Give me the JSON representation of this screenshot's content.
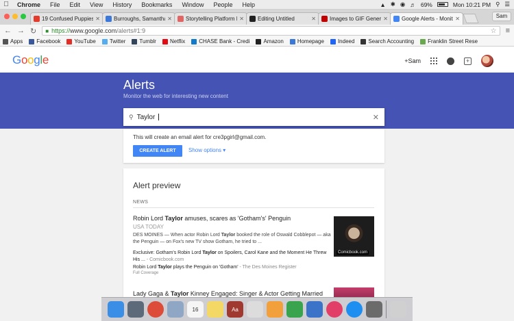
{
  "menubar": {
    "app": "Chrome",
    "items": [
      "File",
      "Edit",
      "View",
      "History",
      "Bookmarks",
      "Window",
      "People",
      "Help"
    ],
    "battery": "69%",
    "clock": "Mon 10:21 PM"
  },
  "tabs": [
    {
      "title": "19 Confused Puppies Lo",
      "color": "#e33b2e"
    },
    {
      "title": "Burroughs, Samantha L",
      "color": "#3c78d8"
    },
    {
      "title": "Storytelling Platform Re",
      "color": "#e06666"
    },
    {
      "title": "Editing Untitled",
      "color": "#222222"
    },
    {
      "title": "Images to GIF Generato",
      "color": "#c00000"
    },
    {
      "title": "Google Alerts - Monitor",
      "color": "#4285f4",
      "active": true
    }
  ],
  "profile": "Sam",
  "omnibox": {
    "scheme": "https://",
    "host": "www.google.com",
    "path": "/alerts#1:9"
  },
  "bookmarks": [
    {
      "label": "Apps",
      "color": "#555555"
    },
    {
      "label": "Facebook",
      "color": "#3b5998"
    },
    {
      "label": "YouTube",
      "color": "#e52d27"
    },
    {
      "label": "Twitter",
      "color": "#55acee"
    },
    {
      "label": "Tumblr",
      "color": "#35465c"
    },
    {
      "label": "Netflix",
      "color": "#e50914"
    },
    {
      "label": "CHASE Bank - Credi",
      "color": "#117aca"
    },
    {
      "label": "Amazon",
      "color": "#222222"
    },
    {
      "label": "Homepage",
      "color": "#3c78d8"
    },
    {
      "label": "Indeed",
      "color": "#2164f3"
    },
    {
      "label": "Search Accounting",
      "color": "#333333"
    },
    {
      "label": "Franklin Street Rese",
      "color": "#6aa84f"
    }
  ],
  "header": {
    "user": "+Sam"
  },
  "band": {
    "title": "Alerts",
    "subtitle": "Monitor the web for interesting new content"
  },
  "search": {
    "value": "Taylor"
  },
  "create": {
    "info": "This will create an email alert for cre3pgirl@gmail.com.",
    "button": "CREATE ALERT",
    "options": "Show options"
  },
  "preview": {
    "title": "Alert preview",
    "section": "NEWS",
    "articles": [
      {
        "head_pre": "Robin Lord ",
        "head_bold": "Taylor",
        "head_post": " amuses, scares as 'Gotham's' Penguin",
        "source": "USA TODAY",
        "snippet_pre": "DES MOINES — When actor Robin Lord ",
        "snippet_bold": "Taylor",
        "snippet_post": " booked the role of Oswald Cobblepot — aka the Penguin — on Fox's new TV show Gotham, he tried to ...",
        "sub1_pre": "Exclusive: Gotham's Robin Lord ",
        "sub1_bold": "Taylor",
        "sub1_post": " on Spoilers, Carol Kane and the Moment He Threw His ...",
        "sub1_src": " - Comicbook.com",
        "sub2_pre": "Robin Lord ",
        "sub2_bold": "Taylor",
        "sub2_post": " plays the Penguin on 'Gotham'",
        "sub2_src": " - The Des Moines Register",
        "coverage": "Full Coverage",
        "thumb_caption": "Comicbook.com"
      },
      {
        "head_pre": "Lady Gaga & ",
        "head_bold": "Taylor",
        "head_post": " Kinney Engaged: Singer & Actor Getting Married"
      }
    ]
  },
  "dock": {
    "apps": [
      {
        "name": "finder",
        "color": "#3a8ee6"
      },
      {
        "name": "launchpad",
        "color": "#5d6a7a"
      },
      {
        "name": "chrome",
        "color": "#dd4b39"
      },
      {
        "name": "preview",
        "color": "#8fa7c4"
      },
      {
        "name": "calendar",
        "color": "#f5f5f5",
        "text": "16"
      },
      {
        "name": "notes",
        "color": "#f3d865"
      },
      {
        "name": "dictionary",
        "color": "#a0392f",
        "text": "Aa"
      },
      {
        "name": "textedit",
        "color": "#dcdcdc"
      },
      {
        "name": "pages",
        "color": "#f2a03c"
      },
      {
        "name": "numbers",
        "color": "#3aa34d"
      },
      {
        "name": "keynote",
        "color": "#3b73c8"
      },
      {
        "name": "itunes",
        "color": "#e23f68"
      },
      {
        "name": "app-store",
        "color": "#1e8ff0"
      },
      {
        "name": "system-preferences",
        "color": "#6b6b6b"
      },
      {
        "name": "trash",
        "color": "#d0d0d0"
      }
    ]
  }
}
